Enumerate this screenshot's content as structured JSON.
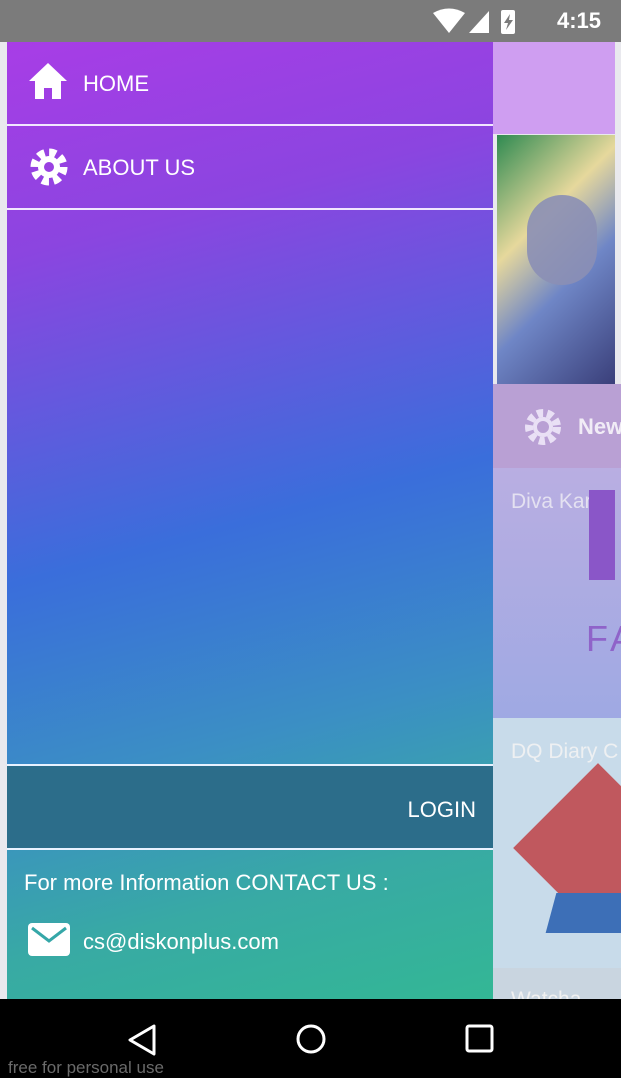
{
  "status_bar": {
    "time": "4:15",
    "icons": [
      "wifi-icon",
      "cell-signal-icon",
      "battery-charging-icon"
    ]
  },
  "drawer": {
    "items": [
      {
        "label": "HOME",
        "icon": "home-icon"
      },
      {
        "label": "ABOUT US",
        "icon": "gear-icon"
      }
    ],
    "login_label": "LOGIN",
    "contact_title": "For more Information CONTACT US :",
    "contact_email": "cs@diskonplus.com"
  },
  "background": {
    "menu_icon": "hamburger-icon",
    "news_label": "New",
    "cards": [
      {
        "title": "Diva Karao"
      },
      {
        "title": "DQ Diary C"
      },
      {
        "title": "Watcha"
      }
    ],
    "card1_logo_text": "FA"
  },
  "nav_bar": {
    "buttons": [
      "back-icon",
      "home-circle-icon",
      "recents-icon"
    ]
  },
  "watermark": "free for personal use",
  "colors": {
    "drawer_top": "#a83de6",
    "drawer_mid": "#3a6edb",
    "drawer_bottom": "#33b795",
    "login_bg": "#2c6d8a",
    "toolbar_bg": "#cf9ef1"
  }
}
